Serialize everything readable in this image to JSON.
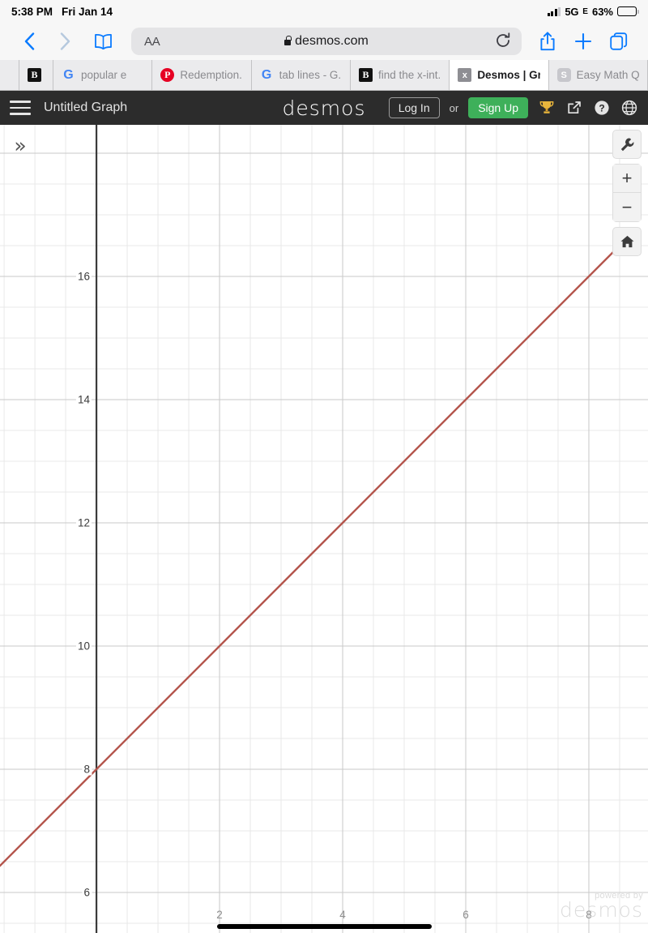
{
  "status_bar": {
    "time": "5:38 PM",
    "date": "Fri Jan 14",
    "network": "5G",
    "network_sub": "E",
    "battery": "63%",
    "signal_icon": "signal-bars-icon",
    "battery_icon": "battery-icon"
  },
  "browser": {
    "back_icon": "chevron-left-icon",
    "forward_icon": "chevron-right-icon",
    "bookmarks_icon": "book-icon",
    "text_size_label": "AA",
    "lock_icon": "lock-icon",
    "url": "desmos.com",
    "reload_icon": "reload-icon",
    "share_icon": "share-icon",
    "new_tab_icon": "plus-icon",
    "tabs_icon": "tabs-icon"
  },
  "tabs": [
    {
      "label": "",
      "favicon": "brainly-icon",
      "favicon_text": "B",
      "favicon_class": "fav-brainly",
      "active": false,
      "narrow": true
    },
    {
      "label": "popular e",
      "favicon": "google-icon",
      "favicon_text": "G",
      "favicon_class": "fav-google",
      "active": false,
      "narrow": false
    },
    {
      "label": "Redemption...",
      "favicon": "pinterest-icon",
      "favicon_text": "P",
      "favicon_class": "fav-pinterest",
      "active": false,
      "narrow": false
    },
    {
      "label": "tab lines - G...",
      "favicon": "google-icon",
      "favicon_text": "G",
      "favicon_class": "fav-google",
      "active": false,
      "narrow": false
    },
    {
      "label": "find the x-int...",
      "favicon": "brainly-icon",
      "favicon_text": "B",
      "favicon_class": "fav-brainly",
      "active": false,
      "narrow": false
    },
    {
      "label": "Desmos | Gr...",
      "favicon": "desmos-icon",
      "favicon_text": "x",
      "favicon_class": "fav-desmos",
      "active": true,
      "narrow": false
    },
    {
      "label": "Easy Math Q...",
      "favicon": "symbolab-icon",
      "favicon_text": "S",
      "favicon_class": "fav-s",
      "active": false,
      "narrow": false
    }
  ],
  "desmos_header": {
    "menu_icon": "hamburger-menu-icon",
    "graph_title": "Untitled Graph",
    "logo": "desmos",
    "login_label": "Log In",
    "or_label": "or",
    "signup_label": "Sign Up",
    "trophy_icon": "trophy-icon",
    "share_icon": "share-icon",
    "help_icon": "help-icon",
    "language_icon": "globe-icon",
    "signup_color": "#3eb05a",
    "header_bg": "#2c2c2c"
  },
  "graph_controls": {
    "expand_list_icon": "chevron-double-right-icon",
    "settings_icon": "wrench-icon",
    "zoom_in_label": "+",
    "zoom_out_label": "−",
    "home_icon": "home-icon"
  },
  "watermark": {
    "line1": "powered by",
    "line2": "desmos"
  },
  "chart_data": {
    "type": "line",
    "title": "",
    "xlabel": "",
    "ylabel": "",
    "xlim": [
      -1.567,
      8.961
    ],
    "ylim": [
      5.342,
      18.46
    ],
    "x_ticks": [
      2,
      4,
      6,
      8
    ],
    "x_tick_labels": [
      "2",
      "4",
      "6",
      "8"
    ],
    "y_ticks": [
      6,
      8,
      10,
      12,
      14,
      16
    ],
    "y_tick_labels": [
      "6",
      "8",
      "10",
      "12",
      "14",
      "16"
    ],
    "grid": true,
    "grid_minor_step": 0.5,
    "grid_major_step": 2,
    "line_color": "#b4554c",
    "axis_color": "#3a3a3a",
    "grid_color": "#e8e8e8",
    "grid_major_color": "#c9c9c9",
    "series": [
      {
        "name": "y = x + 8",
        "slope": 1,
        "intercept": 8,
        "color": "#b4554c",
        "points": [
          {
            "x": -1.567,
            "y": 6.433
          },
          {
            "x": 0,
            "y": 8
          },
          {
            "x": 2,
            "y": 10
          },
          {
            "x": 4,
            "y": 12
          },
          {
            "x": 6,
            "y": 14
          },
          {
            "x": 8.44,
            "y": 16.44
          }
        ]
      }
    ]
  }
}
